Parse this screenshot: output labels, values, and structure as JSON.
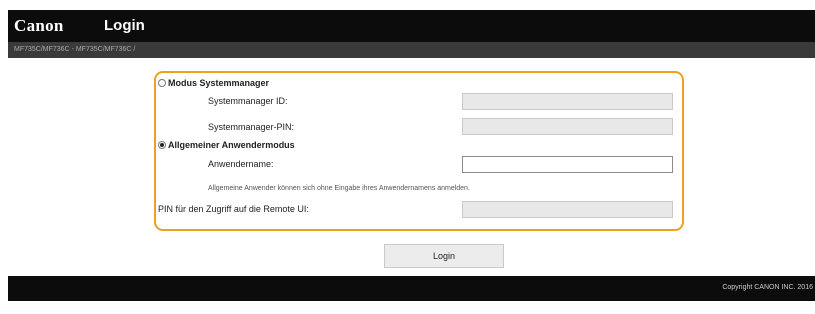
{
  "header": {
    "brand": "Canon",
    "title": "Login"
  },
  "subbar": {
    "text": "MF735C/MF736C - MF735C/MF736C /"
  },
  "form": {
    "system_manager_mode": {
      "label": "Modus Systemmanager",
      "selected": false,
      "id_label": "Systemmanager ID:",
      "id_value": "",
      "pin_label": "Systemmanager-PIN:",
      "pin_value": ""
    },
    "general_user_mode": {
      "label": "Allgemeiner Anwendermodus",
      "selected": true,
      "username_label": "Anwendername:",
      "username_value": "",
      "hint": "Allgemeine Anwender können sich ohne Eingabe ihres Anwendernamens anmelden."
    },
    "remote_ui_pin_label": "PIN für den Zugriff auf die Remote UI:",
    "remote_ui_pin_value": "",
    "accent_color": "#f0a020"
  },
  "login_button": "Login",
  "footer": {
    "copyright": "Copyright CANON INC. 2016"
  }
}
